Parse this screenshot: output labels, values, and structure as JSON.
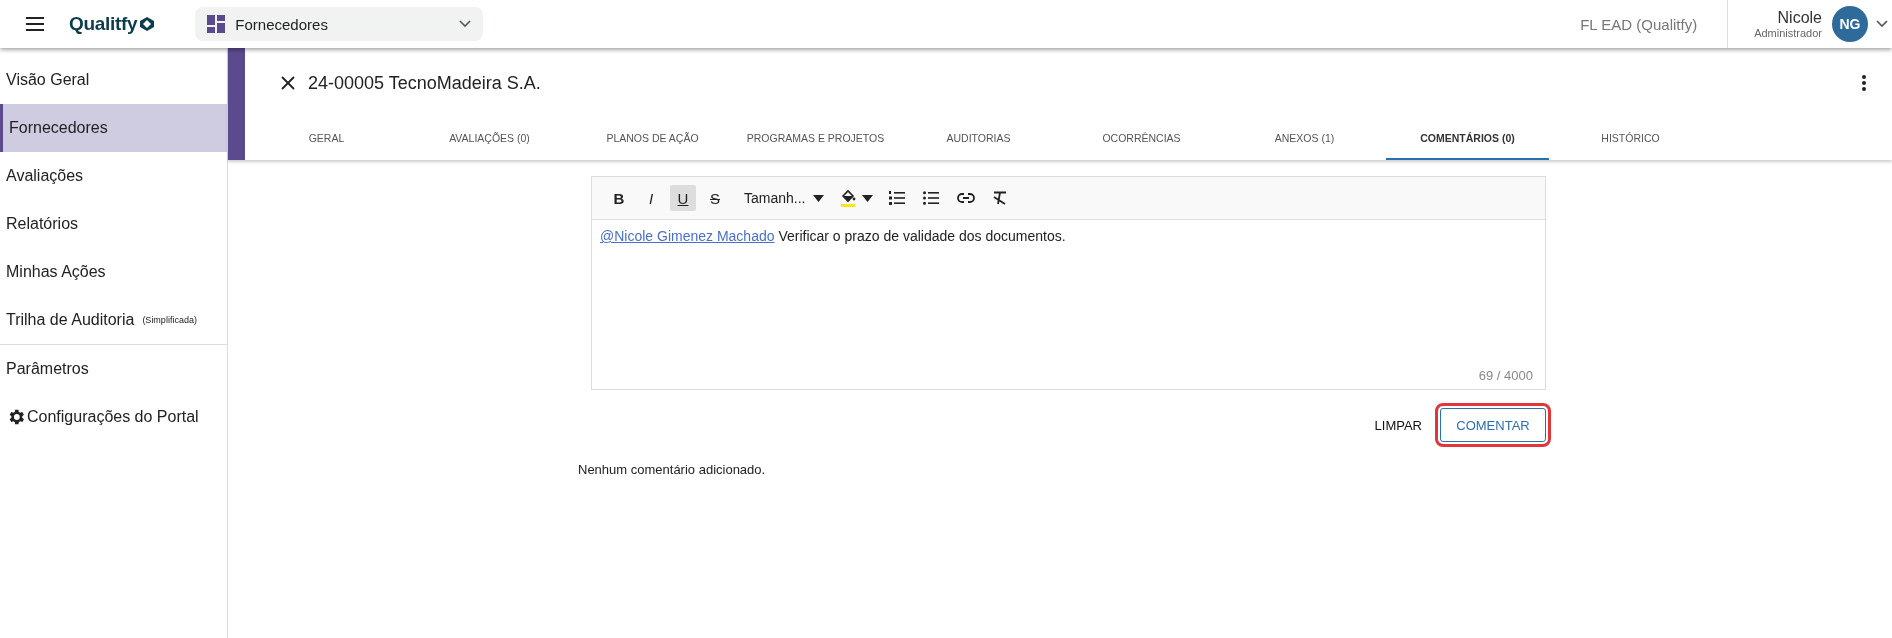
{
  "topbar": {
    "logo": "Qualitfy",
    "module": "Fornecedores",
    "tenant": "FL EAD (Qualitfy)",
    "user": {
      "name": "Nicole",
      "role": "Administrador",
      "initials": "NG"
    }
  },
  "sidebar": {
    "items": [
      {
        "label": "Visão Geral",
        "selected": false,
        "kind": "plain"
      },
      {
        "label": "Fornecedores",
        "selected": true,
        "kind": "plain"
      },
      {
        "label": "Avaliações",
        "selected": false,
        "kind": "plain"
      },
      {
        "label": "Relatórios",
        "selected": false,
        "kind": "plain"
      },
      {
        "label": "Minhas Ações",
        "selected": false,
        "kind": "plain"
      },
      {
        "label": "Trilha de Auditoria",
        "note": "(Simplificada)",
        "selected": false,
        "kind": "noted"
      },
      {
        "label": "Parâmetros",
        "selected": false,
        "kind": "divided"
      },
      {
        "label": "Configurações do Portal",
        "selected": false,
        "kind": "gear"
      }
    ]
  },
  "record": {
    "title": "24-00005 TecnoMadeira S.A.",
    "tabs": [
      {
        "label": "GERAL",
        "selected": false
      },
      {
        "label": "AVALIAÇÕES (0)",
        "selected": false
      },
      {
        "label": "PLANOS DE AÇÃO",
        "selected": false
      },
      {
        "label": "PROGRAMAS E PROJETOS",
        "selected": false
      },
      {
        "label": "AUDITORIAS",
        "selected": false
      },
      {
        "label": "OCORRÊNCIAS",
        "selected": false
      },
      {
        "label": "ANEXOS (1)",
        "selected": false
      },
      {
        "label": "COMENTÁRIOS (0)",
        "selected": true
      },
      {
        "label": "HISTÓRICO",
        "selected": false
      }
    ]
  },
  "editor": {
    "toolbar": [
      {
        "kind": "bold",
        "label": "B",
        "selected": false
      },
      {
        "kind": "italic",
        "label": "I",
        "selected": false
      },
      {
        "kind": "underline",
        "label": "U",
        "selected": true
      },
      {
        "kind": "strike",
        "label": "S",
        "selected": false
      },
      {
        "kind": "size",
        "label": "Tamanh..."
      },
      {
        "kind": "highlight"
      },
      {
        "kind": "ordered-list"
      },
      {
        "kind": "bullet-list"
      },
      {
        "kind": "link"
      },
      {
        "kind": "clear-format"
      }
    ],
    "mention": "@Nicole Gimenez Machado",
    "text": "Verificar o prazo de validade dos documentos.",
    "counter": "69 / 4000"
  },
  "actions": [
    {
      "label": "LIMPAR",
      "kind": "text",
      "highlighted": false
    },
    {
      "label": "COMENTAR",
      "kind": "outlined",
      "highlighted": true
    }
  ],
  "empty_message": "Nenhum comentário adicionado."
}
